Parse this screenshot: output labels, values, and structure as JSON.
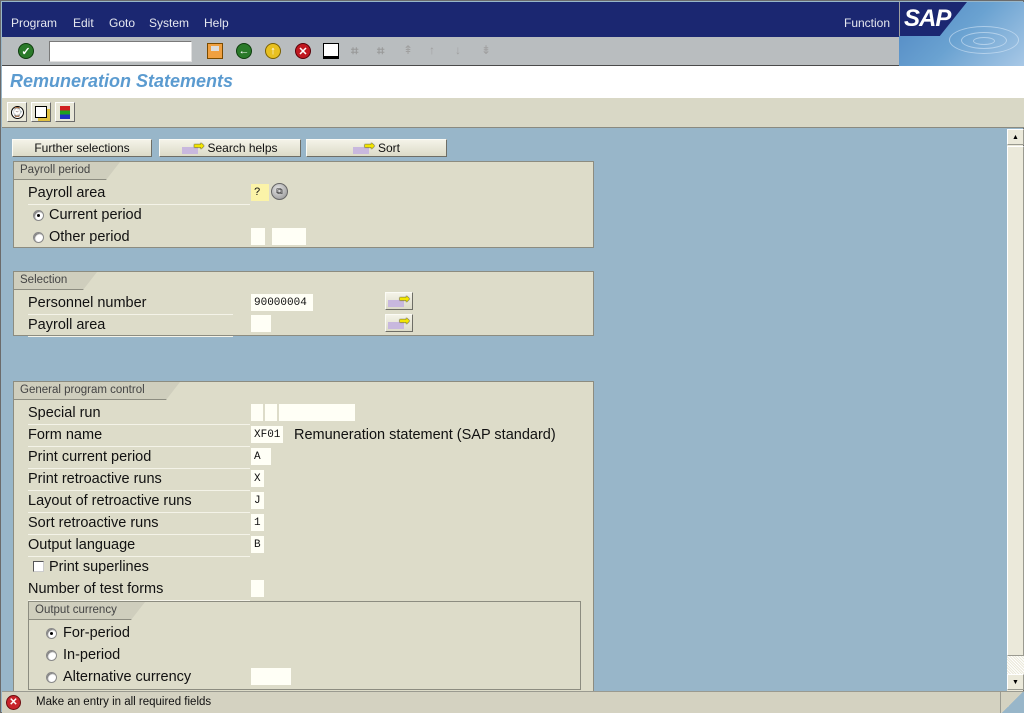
{
  "menubar": {
    "items": [
      "Program",
      "Edit",
      "Goto",
      "System",
      "Help"
    ],
    "function_label": "Function",
    "logo": "SAP"
  },
  "toolbar": {
    "command_field_value": "",
    "icons": [
      "enter-icon",
      "save-icon",
      "back-icon",
      "exit-icon",
      "cancel-icon",
      "print-icon",
      "find-icon",
      "find-next-icon",
      "first-page-icon",
      "previous-page-icon",
      "next-page-icon",
      "last-page-icon"
    ]
  },
  "title": "Remuneration Statements",
  "app_toolbar": {
    "icons": [
      "execute-icon",
      "get-variant-icon",
      "selection-options-icon"
    ]
  },
  "buttons": {
    "further_selections": "Further selections",
    "search_helps": "Search helps",
    "sort": "Sort"
  },
  "payroll_period": {
    "title": "Payroll period",
    "payroll_area_label": "Payroll area",
    "payroll_area_value": "?",
    "current_period_label": "Current period",
    "other_period_label": "Other period",
    "selected": "current_period",
    "other_period_value_1": "",
    "other_period_value_2": ""
  },
  "selection": {
    "title": "Selection",
    "personnel_number_label": "Personnel number",
    "personnel_number_value": "90000004",
    "payroll_area_label": "Payroll area",
    "payroll_area_value": ""
  },
  "general_program_control": {
    "title": "General program control",
    "fields": [
      {
        "label": "Special run",
        "value": ""
      },
      {
        "label": "Form name",
        "value": "XF01",
        "description": "Remuneration statement (SAP standard)"
      },
      {
        "label": "Print current period",
        "value": "A"
      },
      {
        "label": "Print retroactive runs",
        "value": "X"
      },
      {
        "label": "Layout of retroactive runs",
        "value": "J"
      },
      {
        "label": "Sort retroactive runs",
        "value": "1"
      },
      {
        "label": "Output language",
        "value": "B"
      }
    ],
    "print_superlines_label": "Print superlines",
    "print_superlines_checked": false,
    "test_forms_label": "Number of test forms",
    "test_forms_value": ""
  },
  "output_currency": {
    "title": "Output currency",
    "options": [
      "For-period",
      "In-period",
      "Alternative currency"
    ],
    "selected": "For-period",
    "alternative_currency_value": ""
  },
  "status": {
    "type": "error",
    "message": "Make an entry in all required fields"
  },
  "colors": {
    "menubar": "#1b2771",
    "title": "#5b9bd0",
    "background": "#98b6c9",
    "group": "#dddcc9",
    "required_field": "#fbf3a8"
  }
}
